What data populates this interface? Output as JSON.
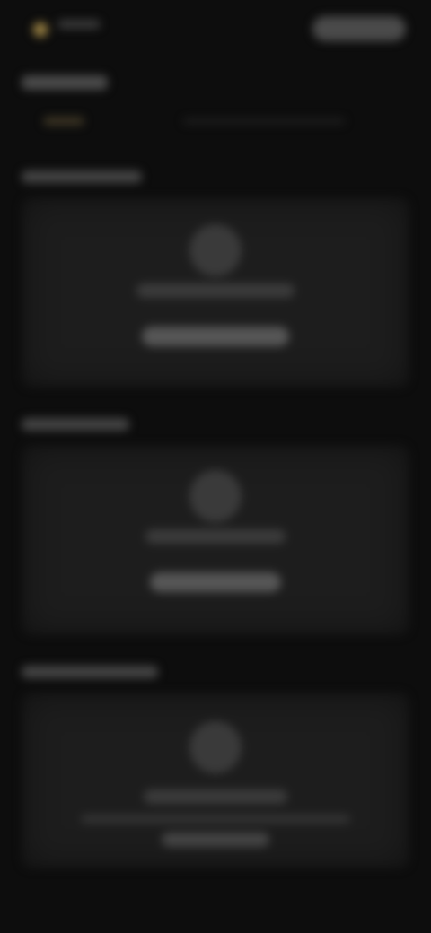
{
  "header": {
    "brand_name": "",
    "action_button_label": ""
  },
  "page": {
    "title": "",
    "subnav": [
      "",
      ""
    ]
  },
  "sections": [
    {
      "title": "",
      "card": {
        "heading": "",
        "button_label": ""
      }
    },
    {
      "title": "",
      "card": {
        "heading": "",
        "button_label": ""
      }
    },
    {
      "title": "",
      "card": {
        "heading": "",
        "description": "",
        "button_label": ""
      }
    }
  ],
  "colors": {
    "background": "#0d0d0d",
    "card": "#1d1d1d",
    "accent": "#b89a52"
  },
  "icons": [
    "brand-logo-icon",
    "card-empty-icon"
  ]
}
